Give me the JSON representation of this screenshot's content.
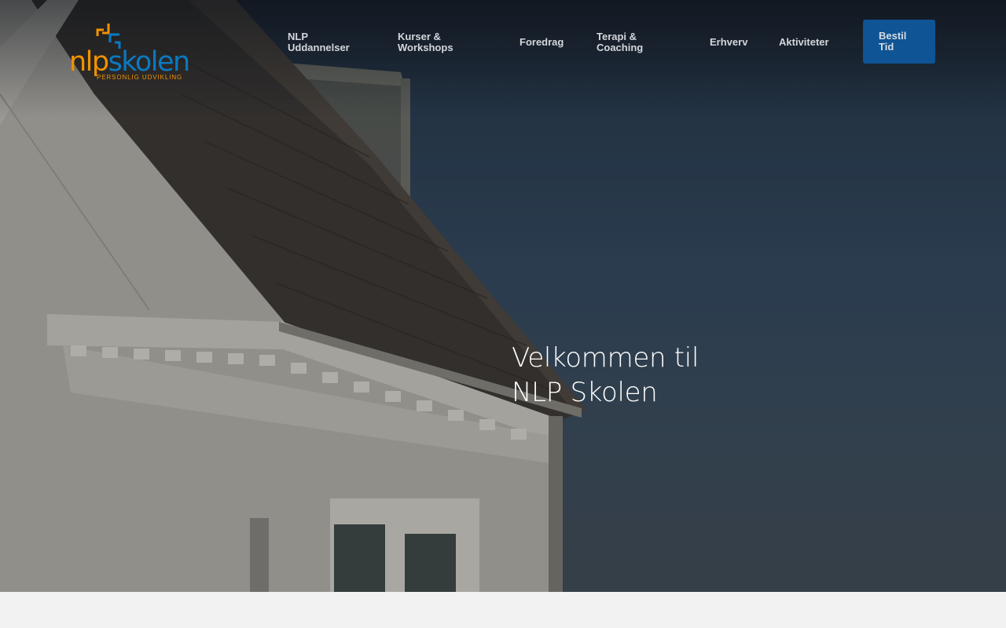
{
  "brand": {
    "logo_part1": "nlp",
    "logo_part2": "skolen",
    "tagline": "PERSONLIG UDVIKLING",
    "colors": {
      "orange": "#f39200",
      "blue": "#0a7ac2"
    }
  },
  "nav": {
    "items": [
      {
        "line1": "NLP",
        "line2": "Uddannelser"
      },
      {
        "line1": "Kurser &",
        "line2": "Workshops"
      },
      {
        "line1": "Foredrag",
        "line2": ""
      },
      {
        "line1": "Terapi &",
        "line2": "Coaching"
      },
      {
        "line1": "Erhverv",
        "line2": ""
      },
      {
        "line1": "Aktiviteter",
        "line2": ""
      }
    ],
    "cta": {
      "line1": "Bestil",
      "line2": "Tid"
    },
    "cta_color": "#0f5494"
  },
  "hero": {
    "headline_line1": "Velkommen til",
    "headline_line2": "NLP Skolen"
  }
}
